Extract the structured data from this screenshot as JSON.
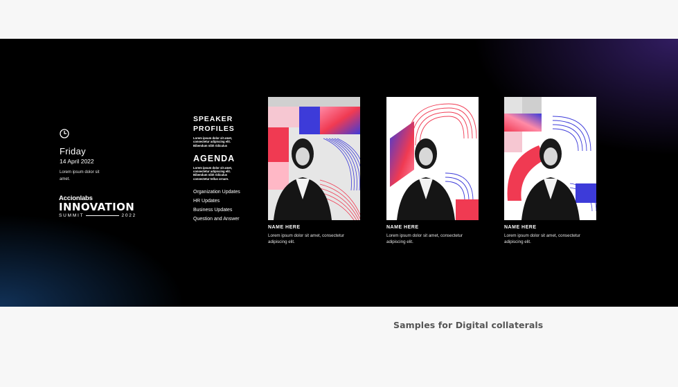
{
  "event": {
    "day": "Friday",
    "date": "14 April 2022",
    "blurb": "Lorem ipsum dolor sit amet."
  },
  "logo": {
    "company": "Accionlabs",
    "title": "INNOVATION",
    "sub_left": "SUMMIT",
    "sub_right": "2022"
  },
  "speaker_section": {
    "heading": "SPEAKER PROFILES",
    "copy": "Lorem ipsum dolor sit amet, consectetur adipiscing elit. Bibendum nibh ridiculus"
  },
  "agenda": {
    "heading": "AGENDA",
    "copy": "Lorem ipsum dolor sit amet, consectetur adipiscing elit. Bibendum nibh ridiculus consectetur tellus ornare.",
    "items": [
      "Organization Updates",
      "HR Updates",
      "Business Updates",
      "Question and Answer"
    ]
  },
  "cards": [
    {
      "name": "NAME HERE",
      "desc": "Lorem ipsum dolor sit amet, consectetur adipiscing elit."
    },
    {
      "name": "NAME HERE",
      "desc": "Lorem ipsum dolor sit amet, consectetur adipiscing elit."
    },
    {
      "name": "NAME HERE",
      "desc": "Lorem ipsum dolor sit amet, consectetur adipiscing elit."
    }
  ],
  "caption": "Samples for Digital collaterals",
  "colors": {
    "banner": "#000000",
    "accent_red": "#f03a52",
    "accent_blue": "#3d3bd9",
    "accent_pink": "#ff8aa6"
  },
  "icons": {
    "clock": "clock-icon"
  }
}
